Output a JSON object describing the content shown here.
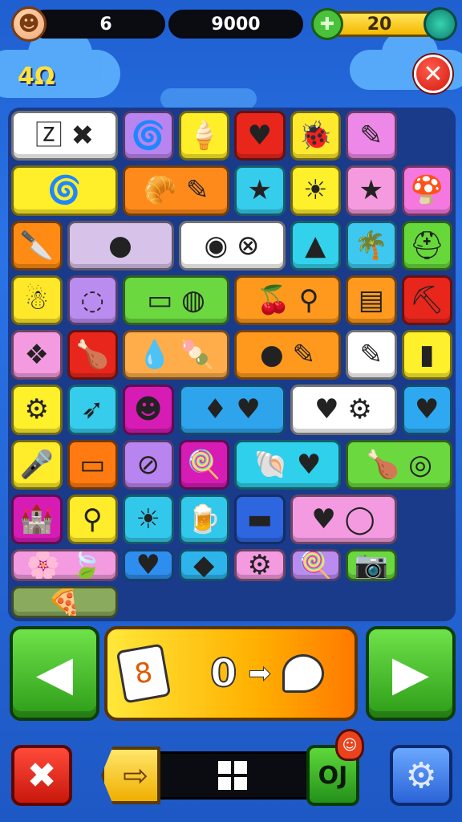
{
  "hud": {
    "avatar_icon": "☻",
    "lives": "6",
    "score": "9000",
    "energy": "20",
    "energy_icon": "✚"
  },
  "level_badge": "4Ω",
  "close_icon": "✕",
  "board": {
    "rows": [
      [
        {
          "bg": "#ffffff",
          "icons": "🅉 ✖",
          "wide": true,
          "name": "tile-sign"
        },
        {
          "bg": "#b884f0",
          "icons": "🌀",
          "wide": false,
          "name": "tile-spiral"
        },
        {
          "bg": "#ffee2a",
          "icons": "🍦",
          "wide": false,
          "name": "tile-icecream"
        },
        {
          "bg": "#e8261c",
          "icons": "♥",
          "wide": false,
          "name": "tile-heart"
        },
        {
          "bg": "#ffe92c",
          "icons": "🐞",
          "wide": false,
          "name": "tile-bug"
        },
        {
          "bg": "#ee88e8",
          "icons": "✎",
          "wide": false,
          "name": "tile-pen"
        },
        {
          "bg": "#ffee2a",
          "icons": "🌀",
          "wide": true,
          "name": "tile-disc"
        }
      ],
      [
        {
          "bg": "#ff8a1c",
          "icons": "🥐 ✎",
          "wide": true,
          "name": "tile-croissant"
        },
        {
          "bg": "#36ccec",
          "icons": "★",
          "wide": false,
          "name": "tile-star-orange"
        },
        {
          "bg": "#fff02c",
          "icons": "☀",
          "wide": false,
          "name": "tile-sun"
        },
        {
          "bg": "#f69adf",
          "icons": "★",
          "wide": false,
          "name": "tile-star-gold"
        },
        {
          "bg": "#f478e0",
          "icons": "🍄",
          "wide": false,
          "name": "tile-mushroom"
        },
        {
          "bg": "#ff8b14",
          "icons": "🔪",
          "wide": false,
          "name": "tile-knife"
        },
        {
          "bg": "#d7c2ea",
          "icons": "●",
          "wide": true,
          "name": "tile-purple-orb"
        }
      ],
      [
        {
          "bg": "#ffffff",
          "icons": "◉ ⊗",
          "wide": true,
          "name": "tile-orbs"
        },
        {
          "bg": "#32d2ec",
          "icons": "▲",
          "wide": false,
          "name": "tile-iceberg"
        },
        {
          "bg": "#3ec8f0",
          "icons": "🌴",
          "wide": false,
          "name": "tile-palm"
        },
        {
          "bg": "#66d83a",
          "icons": "⛑",
          "wide": false,
          "name": "tile-helmet"
        },
        {
          "bg": "#ffe82a",
          "icons": "☃",
          "wide": false,
          "name": "tile-figure"
        },
        {
          "bg": "#ba8cf0",
          "icons": "◌",
          "wide": false,
          "name": "tile-ring"
        },
        {
          "bg": "#6ad83e",
          "icons": "▭ ◍",
          "wide": true,
          "name": "tile-tag-ball"
        }
      ],
      [
        {
          "bg": "#ff991e",
          "icons": "🍒 ⚲",
          "wide": true,
          "name": "tile-cherry-loop"
        },
        {
          "bg": "#ff9a1e",
          "icons": "▤",
          "wide": false,
          "name": "tile-box"
        },
        {
          "bg": "#e8261c",
          "icons": "⛏",
          "wide": false,
          "name": "tile-pickaxe"
        },
        {
          "bg": "#f49ae0",
          "icons": "❖",
          "wide": false,
          "name": "tile-badge"
        },
        {
          "bg": "#e8261c",
          "icons": "🍗",
          "wide": false,
          "name": "tile-drumstick"
        },
        {
          "bg": "#ffad4a",
          "icons": "💧 🍡",
          "wide": true,
          "name": "tile-drop-pop"
        }
      ],
      [
        {
          "bg": "#ff991e",
          "icons": "● ✎",
          "wide": true,
          "name": "tile-lolly-pen"
        },
        {
          "bg": "#ffffff",
          "icons": "✎",
          "wide": false,
          "name": "tile-crayon"
        },
        {
          "bg": "#fff02c",
          "icons": "▮",
          "wide": false,
          "name": "tile-tube"
        },
        {
          "bg": "#fff02c",
          "icons": "⚙",
          "wide": false,
          "name": "tile-ring-badge"
        },
        {
          "bg": "#36ccec",
          "icons": "➶",
          "wide": false,
          "name": "tile-arrow"
        },
        {
          "bg": "#d61cb4",
          "icons": "☻",
          "wide": false,
          "name": "tile-blob"
        },
        {
          "bg": "#2ea4ec",
          "icons": "♦ ♥",
          "wide": true,
          "name": "tile-gem-heart"
        }
      ],
      [
        {
          "bg": "#ffffff",
          "icons": "♥ ⚙",
          "wide": true,
          "name": "tile-heart-gear"
        },
        {
          "bg": "#2ea8f0",
          "icons": "♥",
          "wide": false,
          "name": "tile-heart-purple"
        },
        {
          "bg": "#ffec2a",
          "icons": "🎤",
          "wide": false,
          "name": "tile-mic"
        },
        {
          "bg": "#ff7a10",
          "icons": "▭",
          "wide": false,
          "name": "tile-battery"
        },
        {
          "bg": "#b884f0",
          "icons": "⊘",
          "wide": false,
          "name": "tile-no-sign"
        },
        {
          "bg": "#d61cb4",
          "icons": "🍭",
          "wide": false,
          "name": "tile-lollipop"
        },
        {
          "bg": "#2ed0ec",
          "icons": "🐚 ♥",
          "wide": true,
          "name": "tile-shell-heart"
        }
      ],
      [
        {
          "bg": "#6ad83e",
          "icons": "🍗 ◎",
          "wide": true,
          "name": "tile-leg-rainbow"
        },
        {
          "bg": "#d61cb4",
          "icons": "🏰",
          "wide": false,
          "name": "tile-castle"
        },
        {
          "bg": "#ffec2a",
          "icons": "⚲",
          "wide": false,
          "name": "tile-key"
        },
        {
          "bg": "#32c8ec",
          "icons": "☀",
          "wide": false,
          "name": "tile-sun-red"
        },
        {
          "bg": "#32c8ec",
          "icons": "🍺",
          "wide": false,
          "name": "tile-mug"
        },
        {
          "bg": "#2e66e0",
          "icons": "▬",
          "wide": false,
          "name": "tile-stick"
        },
        {
          "bg": "#f49ae0",
          "icons": "♥ ◯",
          "wide": true,
          "name": "tile-heart-ring"
        }
      ],
      [
        {
          "bg": "#f49ae0",
          "icons": "🌸 🍃",
          "wide": true,
          "name": "tile-flower-leaf"
        },
        {
          "bg": "#2e8ef0",
          "icons": "♥",
          "wide": false,
          "name": "tile-heart-gold"
        },
        {
          "bg": "#2eb4ec",
          "icons": "◆",
          "wide": false,
          "name": "tile-crystal"
        },
        {
          "bg": "#f49ae0",
          "icons": "⚙",
          "wide": false,
          "name": "tile-gear-blue"
        },
        {
          "bg": "#ba8cf0",
          "icons": "🍭",
          "wide": false,
          "name": "tile-candy"
        },
        {
          "bg": "#6ad83e",
          "icons": "📷",
          "wide": false,
          "name": "tile-camera"
        },
        {
          "bg": "#8aaa5e",
          "icons": "🍕",
          "wide": true,
          "name": "tile-slice"
        }
      ]
    ]
  },
  "controls": {
    "left_arrow": "◀",
    "right_arrow": "▶",
    "panel_icon": "8",
    "panel_value": "0",
    "panel_arrow": "➡"
  },
  "bottom": {
    "x_icon": "✖",
    "next_icon": "⇨",
    "green_label": "OJ",
    "mascot_icon": "☺",
    "gear_icon": "⚙"
  }
}
